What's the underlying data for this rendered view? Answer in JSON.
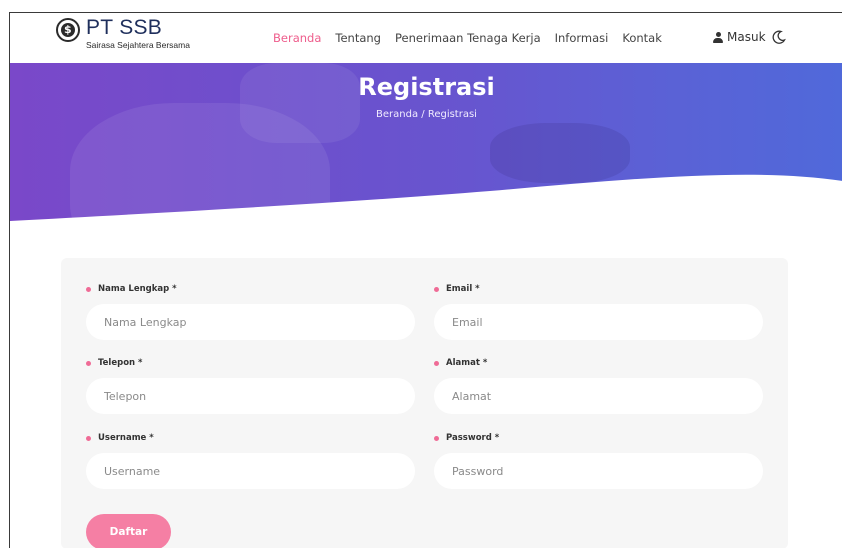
{
  "brand": {
    "title": "PT SSB",
    "subtitle": "Sairasa Sejahtera Bersama"
  },
  "nav": {
    "items": [
      {
        "label": "Beranda",
        "active": true
      },
      {
        "label": "Tentang",
        "active": false
      },
      {
        "label": "Penerimaan Tenaga Kerja",
        "active": false
      },
      {
        "label": "Informasi",
        "active": false
      },
      {
        "label": "Kontak",
        "active": false
      }
    ],
    "login_label": "Masuk"
  },
  "hero": {
    "title": "Registrasi",
    "breadcrumb": "Beranda / Registrasi"
  },
  "form": {
    "fields": [
      {
        "label": "Nama Lengkap *",
        "placeholder": "Nama Lengkap",
        "value": ""
      },
      {
        "label": "Email *",
        "placeholder": "Email",
        "value": ""
      },
      {
        "label": "Telepon *",
        "placeholder": "Telepon",
        "value": ""
      },
      {
        "label": "Alamat *",
        "placeholder": "Alamat",
        "value": ""
      },
      {
        "label": "Username *",
        "placeholder": "Username",
        "value": ""
      },
      {
        "label": "Password *",
        "placeholder": "Password",
        "value": ""
      }
    ],
    "submit_label": "Daftar"
  },
  "colors": {
    "accent_pink": "#ee5d8c",
    "button_pink": "#f57fa4",
    "hero_start": "#7a48c9",
    "hero_end": "#5069da",
    "brand_navy": "#1f2f5c"
  },
  "icons": {
    "logo": "ssb-logo-icon",
    "user": "user-icon",
    "theme": "moon-icon"
  }
}
